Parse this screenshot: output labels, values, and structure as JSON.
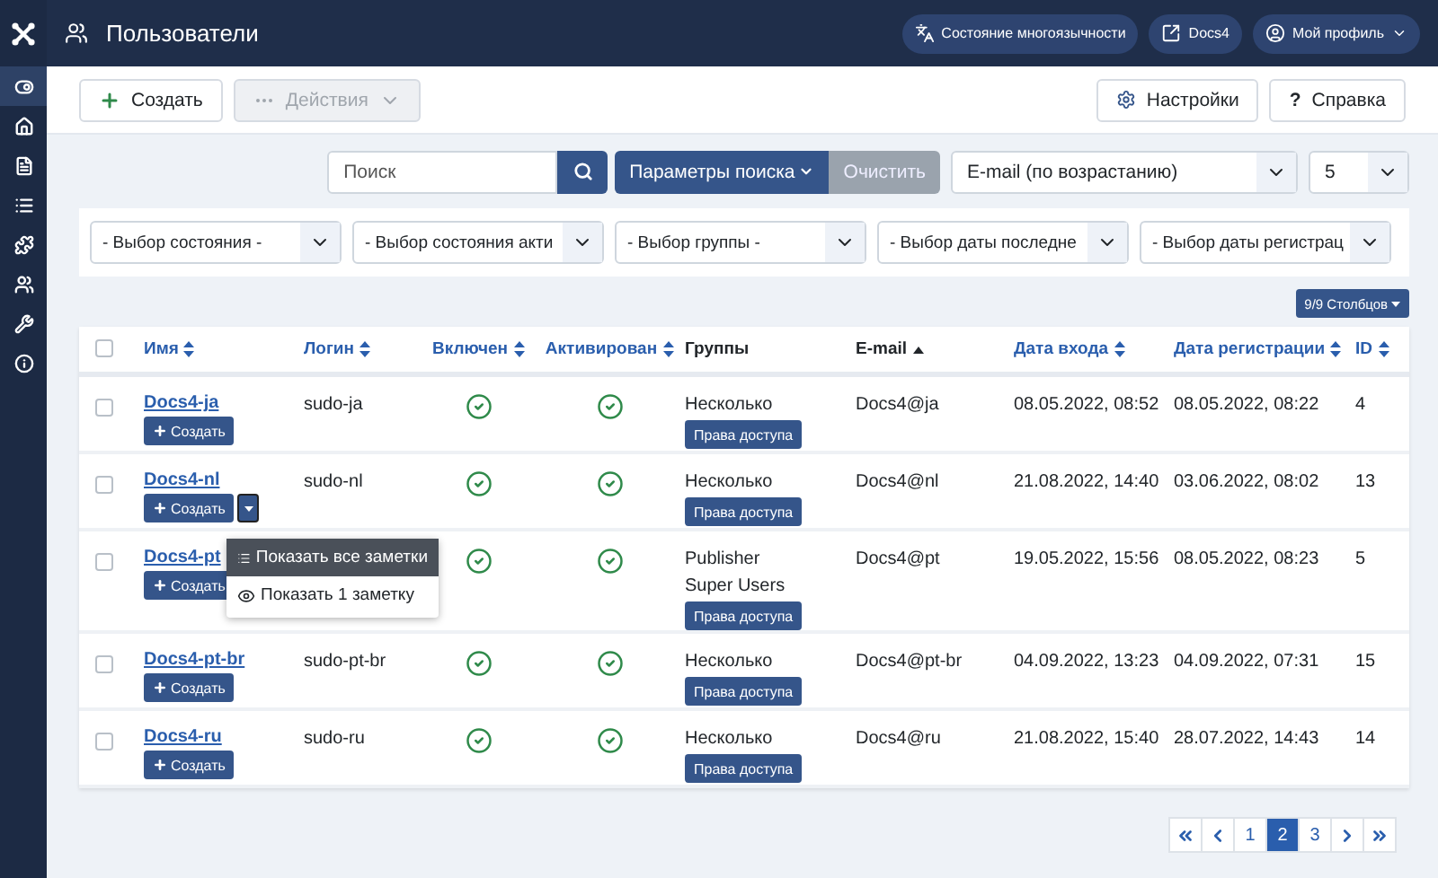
{
  "header": {
    "title": "Пользователи",
    "buttons": [
      {
        "kind": "language",
        "label": "Состояние многоязычности"
      },
      {
        "kind": "site",
        "label": "Docs4"
      },
      {
        "kind": "profile",
        "label": "Мой профиль"
      }
    ]
  },
  "sidebar": {
    "items": [
      {
        "kind": "toggle",
        "selected": true
      },
      {
        "kind": "home",
        "selected": false
      },
      {
        "kind": "file",
        "selected": false
      },
      {
        "kind": "list",
        "selected": false
      },
      {
        "kind": "puzzle",
        "selected": false
      },
      {
        "kind": "users",
        "selected": false
      },
      {
        "kind": "wrench",
        "selected": false
      },
      {
        "kind": "info",
        "selected": false
      }
    ]
  },
  "toolbar": {
    "create": "Создать",
    "actions": {
      "label": "Действия",
      "disabled": true
    },
    "settings": "Настройки",
    "help": {
      "icon": "?",
      "label": "Справка"
    }
  },
  "search": {
    "placeholder": "Поиск",
    "options": "Параметры поиска",
    "clear": "Очистить",
    "ordering": "E-mail (по возрастанию)",
    "limit": "5"
  },
  "filters": [
    "- Выбор состояния -",
    "- Выбор состояния акти",
    "- Выбор группы -",
    "- Выбор даты последне",
    "- Выбор даты регистрац"
  ],
  "columns_button": "9/9 Столбцов",
  "table": {
    "select_all_checked": false,
    "columns": [
      {
        "label": "Имя",
        "sortable": true
      },
      {
        "label": "Логин",
        "sortable": true
      },
      {
        "label": "Включен",
        "sortable": true
      },
      {
        "label": "Активирован",
        "sortable": true
      },
      {
        "label": "Группы",
        "sortable": false
      },
      {
        "label": "E-mail",
        "sortable": true,
        "sorted_ascending": true
      },
      {
        "label": "Дата входа",
        "sortable": true
      },
      {
        "label": "Дата регистрации",
        "sortable": true
      },
      {
        "label": "ID",
        "sortable": true
      }
    ],
    "rows": [
      {
        "checked": false,
        "name": "Docs4-ja",
        "create": "Создать",
        "notes_toggle": false,
        "login": "sudo-ja",
        "enabled": true,
        "activated": true,
        "groups": [
          "Несколько"
        ],
        "access": "Права доступа",
        "email": "Docs4@ja",
        "last_visit": "08.05.2022, 08:52",
        "registered": "08.05.2022, 08:22",
        "id": "4"
      },
      {
        "checked": false,
        "name": "Docs4-nl",
        "create": "Создать",
        "notes_toggle": true,
        "notes_menu": [
          {
            "kind": "list",
            "label": "Показать все заметки",
            "selected": true
          },
          {
            "kind": "eye",
            "label": "Показать 1 заметку",
            "selected": false
          }
        ],
        "login": "sudo-nl",
        "enabled": true,
        "activated": true,
        "groups": [
          "Несколько"
        ],
        "access": "Права доступа",
        "email": "Docs4@nl",
        "last_visit": "21.08.2022, 14:40",
        "registered": "03.06.2022, 08:02",
        "id": "13"
      },
      {
        "checked": false,
        "name": "Docs4-pt",
        "create": "Создать",
        "notes_toggle": false,
        "enabled": true,
        "activated": true,
        "groups": [
          "Publisher",
          "Super Users"
        ],
        "access": "Права доступа",
        "email": "Docs4@pt",
        "last_visit": "19.05.2022, 15:56",
        "registered": "08.05.2022, 08:23",
        "id": "5"
      },
      {
        "checked": false,
        "name": "Docs4-pt-br",
        "create": "Создать",
        "notes_toggle": false,
        "login": "sudo-pt-br",
        "enabled": true,
        "activated": true,
        "groups": [
          "Несколько"
        ],
        "access": "Права доступа",
        "email": "Docs4@pt-br",
        "last_visit": "04.09.2022, 13:23",
        "registered": "04.09.2022, 07:31",
        "id": "15"
      },
      {
        "checked": false,
        "name": "Docs4-ru",
        "create": "Создать",
        "notes_toggle": false,
        "login": "sudo-ru",
        "enabled": true,
        "activated": true,
        "groups": [
          "Несколько"
        ],
        "access": "Права доступа",
        "email": "Docs4@ru",
        "last_visit": "21.08.2022, 15:40",
        "registered": "28.07.2022, 14:43",
        "id": "14"
      }
    ]
  },
  "pagination": [
    {
      "kind": "first",
      "selected": false
    },
    {
      "kind": "prev",
      "selected": false
    },
    {
      "kind": "page",
      "label": "1",
      "selected": false
    },
    {
      "kind": "page",
      "label": "2",
      "selected": true
    },
    {
      "kind": "page",
      "label": "3",
      "selected": false
    },
    {
      "kind": "next",
      "selected": false
    },
    {
      "kind": "last",
      "selected": false
    }
  ]
}
